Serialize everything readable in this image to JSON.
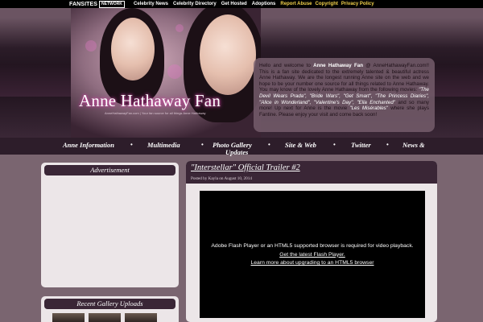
{
  "network": {
    "logo_main": "FANSITES",
    "logo_badge": "NETWORK",
    "links": [
      "Celebrity News",
      "Celebrity Directory",
      "Get Hosted",
      "Adoptions"
    ],
    "highlight_links": [
      "Report Abuse",
      "Copyright",
      "Privacy Policy"
    ]
  },
  "header": {
    "title": "Anne Hathaway Fan",
    "tagline": "AnneHathawayFan.com | Your fan source for all things Anne Hathaway"
  },
  "welcome": {
    "p1": "Hello and welcome to ",
    "site_name": "Anne Hathaway Fan",
    "p2": " @ AnneHathawayFan.com!! This is a fan site dedicated to the extremely talented & beautiful actress Anne Hathaway. We are the longest running Anne site on the web and we hope to be your number one source for all things related to Anne Hathaway. You may know of the lovely Anne Hathaway from the following movies: ",
    "movies": "\"The Devil Wears Prada\", \"Bride Wars\", \"Get Smart\", \"The Princess Diaries\", \"Alice in Wonderland\", \"Valentine's Day\", \"Ella Enchanted\"",
    "p3": " and so many more! Up next for Anne is the movie ",
    "next_movie": "\"Les Misérables\"",
    "p4": " where she plays Fantine. Please enjoy your visit and come back soon!"
  },
  "nav": {
    "items": [
      "Anne Information",
      "Multimedia",
      "Photo Gallery",
      "Site & Web",
      "Twitter",
      "News &"
    ],
    "continuation": [
      "Updates"
    ],
    "separator": "•"
  },
  "sidebar": {
    "advertisement_title": "Advertisement",
    "gallery_title": "Recent Gallery Uploads"
  },
  "post": {
    "title": "\"Interstellar\" Official Trailer #2",
    "meta": "Posted by Kayla on August 10, 2014",
    "video_message": "Adobe Flash Player or an HTML5 supported browser is required for video playback.",
    "video_link1": "Get the latest Flash Player.",
    "video_link2": "Learn more about upgrading to an HTML5 browser"
  },
  "colors": {
    "page_bg": "#7a6570",
    "panel_dark": "#3a2636",
    "panel_light": "#ece6e8",
    "network_highlight": "#f3d24a",
    "title_glow": "#d64aa4"
  }
}
